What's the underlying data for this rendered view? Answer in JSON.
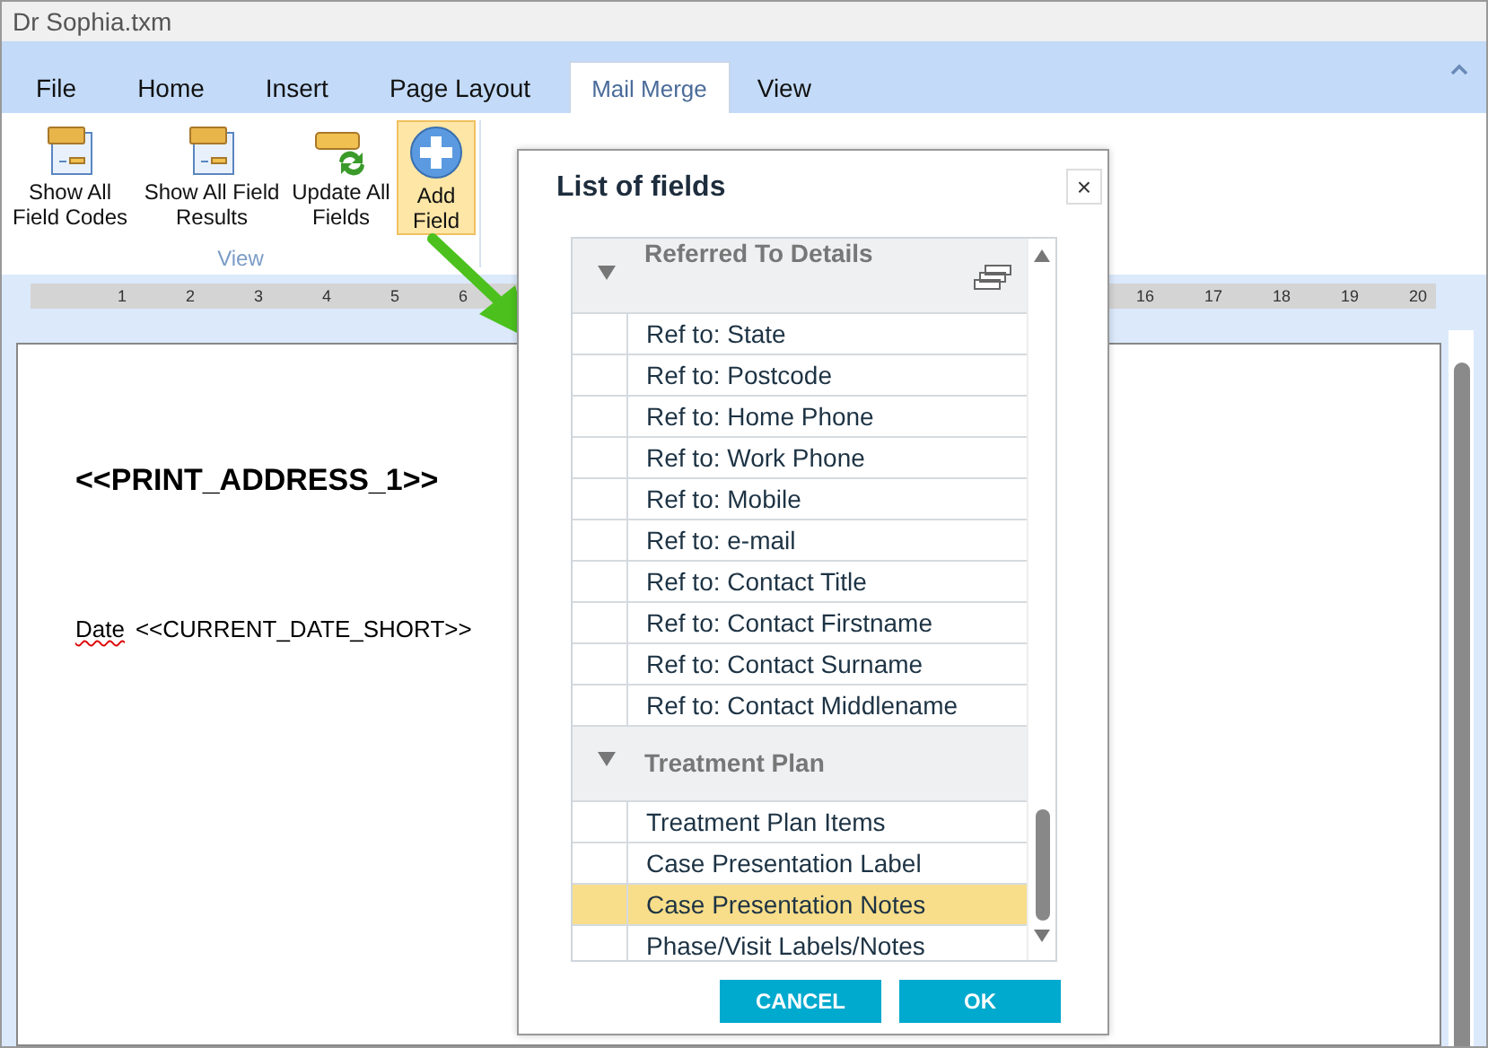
{
  "window": {
    "title": "Dr Sophia.txm"
  },
  "tabs": [
    {
      "label": "File",
      "selected": false
    },
    {
      "label": "Home",
      "selected": false
    },
    {
      "label": "Insert",
      "selected": false
    },
    {
      "label": "Page Layout",
      "selected": false
    },
    {
      "label": "Mail Merge",
      "selected": true
    },
    {
      "label": "View",
      "selected": false
    }
  ],
  "ribbon": {
    "group_label": "View",
    "buttons": [
      {
        "kind": "codes",
        "label": "Show All Field Codes",
        "selected": false
      },
      {
        "kind": "results",
        "label": "Show All Field Results",
        "selected": false
      },
      {
        "kind": "update",
        "label": "Update All Fields",
        "selected": false
      },
      {
        "kind": "add",
        "label": "Add Field",
        "selected": true
      }
    ]
  },
  "ruler": {
    "left_numbers": [
      "1",
      "2",
      "3",
      "4",
      "5",
      "6"
    ],
    "right_numbers": [
      "16",
      "17",
      "18",
      "19",
      "20"
    ]
  },
  "document": {
    "heading": "<<PRINT_ADDRESS_1>>",
    "date_label": "Date",
    "date_field": "<<CURRENT_DATE_SHORT>>"
  },
  "dialog": {
    "title": "List of fields",
    "close": "×",
    "groups": [
      {
        "name": "Referred To Details",
        "expanded": true,
        "items": [
          {
            "label": "Ref to: State",
            "selected": false
          },
          {
            "label": "Ref to: Postcode",
            "selected": false
          },
          {
            "label": "Ref to: Home Phone",
            "selected": false
          },
          {
            "label": "Ref to: Work Phone",
            "selected": false
          },
          {
            "label": "Ref to: Mobile",
            "selected": false
          },
          {
            "label": "Ref to: e-mail",
            "selected": false
          },
          {
            "label": "Ref to: Contact Title",
            "selected": false
          },
          {
            "label": "Ref to: Contact Firstname",
            "selected": false
          },
          {
            "label": "Ref to: Contact Surname",
            "selected": false
          },
          {
            "label": "Ref to: Contact Middlename",
            "selected": false
          }
        ]
      },
      {
        "name": "Treatment Plan",
        "expanded": true,
        "items": [
          {
            "label": "Treatment Plan Items",
            "selected": false
          },
          {
            "label": "Case Presentation Label",
            "selected": false
          },
          {
            "label": "Case Presentation Notes",
            "selected": true
          },
          {
            "label": "Phase/Visit Labels/Notes",
            "selected": false
          }
        ]
      }
    ],
    "buttons": [
      "CANCEL",
      "OK"
    ]
  }
}
